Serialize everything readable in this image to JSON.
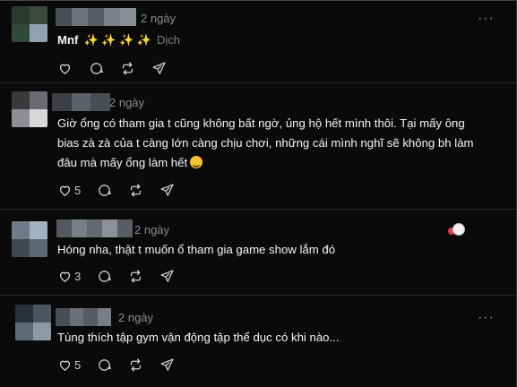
{
  "posts": [
    {
      "time": "2 ngày",
      "text": "Mnf",
      "sparkles": "✨ ✨ ✨ ✨",
      "translate": "Dịch",
      "likes": "",
      "avatar_colors": [
        "#2b3a2e",
        "#3c4a3d",
        "#2f4a36",
        "#8fa3b0"
      ],
      "name_colors": [
        "#4a4e55",
        "#6e727a",
        "#595d64",
        "#7c8088",
        "#8a8e96"
      ]
    },
    {
      "time": "2 ngày",
      "text": "Giờ ổng có tham gia t cũng không bất ngờ, ủng hộ hết mình thôi. Tại mấy ông bias zà zà của t càng lớn càng chịu chơi, những cái mình nghĩ sẽ không bh làm đâu mà mấy ổng làm hết",
      "emoji": "face-with-tears-of-joy",
      "likes": "5",
      "avatar_colors": [
        "#3a3a3d",
        "#6a6a70",
        "#8e8e94",
        "#d8d8db"
      ],
      "name_colors": [
        "#3d3f44",
        "#5d6066",
        "#4a4d52"
      ]
    },
    {
      "time": "2 ngày",
      "text": "Hóng nha, thật t muốn ổ tham gia game show lắm đó",
      "likes": "3",
      "reaction": "heart-reaction",
      "avatar_colors": [
        "#6d7c88",
        "#9fb3c2",
        "#3f4850",
        "#5d6a74"
      ],
      "name_colors": [
        "#55585e",
        "#7a7e85",
        "#65686e",
        "#8d9097",
        "#5a5d63"
      ]
    },
    {
      "time": "2 ngày",
      "text": "Tùng thích tập gym vận động tập thể dục có khi nào...",
      "likes": "5",
      "avatar_colors": [
        "#2a3038",
        "#4a5560",
        "#5d6b78",
        "#8d9aa6"
      ],
      "name_colors": [
        "#4a4d53",
        "#6c6f76",
        "#585b61",
        "#7a7d84"
      ]
    }
  ],
  "icons": {
    "like": "heart-icon",
    "comment": "comment-icon",
    "repost": "repost-icon",
    "share": "send-icon",
    "more": "more-icon"
  }
}
